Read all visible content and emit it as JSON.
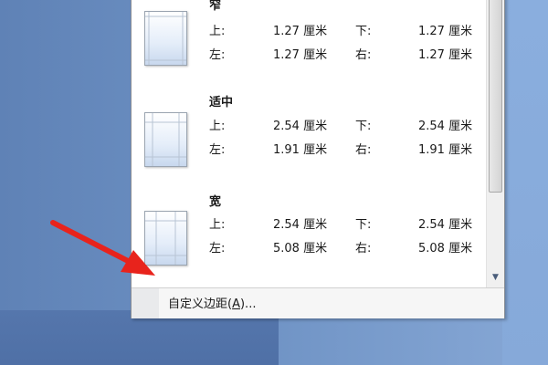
{
  "margins_menu": {
    "options": [
      {
        "title": "窄",
        "top_label": "上:",
        "top_value": "1.27 厘米",
        "bottom_label": "下:",
        "bottom_value": "1.27 厘米",
        "left_label": "左:",
        "left_value": "1.27 厘米",
        "right_label": "右:",
        "right_value": "1.27 厘米",
        "icon": "margin-narrow-icon"
      },
      {
        "title": "适中",
        "top_label": "上:",
        "top_value": "2.54 厘米",
        "bottom_label": "下:",
        "bottom_value": "2.54 厘米",
        "left_label": "左:",
        "left_value": "1.91 厘米",
        "right_label": "右:",
        "right_value": "1.91 厘米",
        "icon": "margin-moderate-icon"
      },
      {
        "title": "宽",
        "top_label": "上:",
        "top_value": "2.54 厘米",
        "bottom_label": "下:",
        "bottom_value": "2.54 厘米",
        "left_label": "左:",
        "left_value": "5.08 厘米",
        "right_label": "右:",
        "right_value": "5.08 厘米",
        "icon": "margin-wide-icon"
      }
    ],
    "footer": {
      "custom_prefix": "自定义边距(",
      "custom_accel": "A",
      "custom_suffix": ")..."
    }
  },
  "scrollbar": {
    "up_icon": "chevron-up-icon",
    "down_icon": "chevron-down-icon"
  },
  "annotation": {
    "icon": "red-arrow-icon",
    "color": "#e8231c"
  },
  "colors": {
    "background": "#6e92c4",
    "menu_bg": "#ffffff",
    "arrow": "#e8231c"
  }
}
